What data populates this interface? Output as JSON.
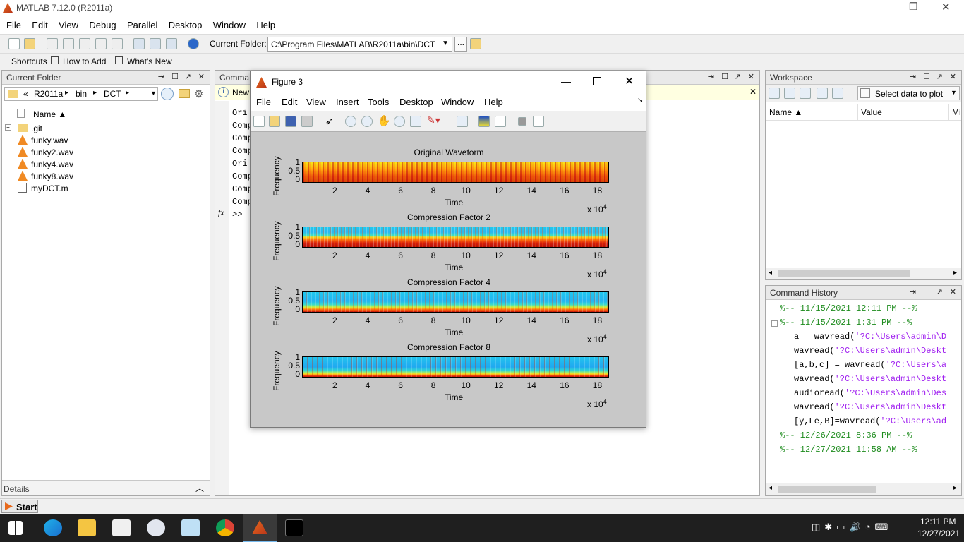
{
  "window": {
    "title": "MATLAB  7.12.0 (R2011a)",
    "min": "—",
    "max": "❐",
    "close": "✕"
  },
  "menu": [
    "File",
    "Edit",
    "View",
    "Debug",
    "Parallel",
    "Desktop",
    "Window",
    "Help"
  ],
  "toolbar": {
    "folder_label": "Current Folder:",
    "folder_path": "C:\\Program Files\\MATLAB\\R2011a\\bin\\DCT",
    "browse": "..."
  },
  "shortcuts": {
    "label": "Shortcuts",
    "how_to_add": "How to Add",
    "whats_new": "What's New"
  },
  "current_folder": {
    "title": "Current Folder",
    "path": [
      "«",
      "R2011a",
      "▸",
      "bin",
      "▸",
      "DCT",
      "▸"
    ],
    "col_name": "Name ▲",
    "files": [
      {
        "name": ".git",
        "icon": "folder-icon"
      },
      {
        "name": "funky.wav",
        "icon": "vlc-icon"
      },
      {
        "name": "funky2.wav",
        "icon": "vlc-icon"
      },
      {
        "name": "funky4.wav",
        "icon": "vlc-icon"
      },
      {
        "name": "funky8.wav",
        "icon": "vlc-icon"
      },
      {
        "name": "myDCT.m",
        "icon": "mfile-icon"
      }
    ],
    "details": "Details"
  },
  "command_window": {
    "title": "Comma",
    "banner": "New",
    "lines": [
      "Ori",
      "Comp",
      "Comp",
      "Comp",
      "Ori",
      "Comp",
      "Comp",
      "Comp"
    ],
    "prompt": ">>",
    "fx": "fx"
  },
  "workspace": {
    "title": "Workspace",
    "select_data": "Select data to plot",
    "col_name": "Name ▲",
    "col_value": "Value",
    "col_min": "Mi"
  },
  "history": {
    "title": "Command History",
    "entries": [
      {
        "text": "%-- 11/15/2021 12:11 PM --%",
        "kind": "sep"
      },
      {
        "text": "%-- 11/15/2021 1:31 PM --%",
        "kind": "sep"
      },
      {
        "cmd": "a = wavread(",
        "arg": "'?C:\\Users\\admin\\D",
        "kind": "cmd"
      },
      {
        "cmd": "wavread(",
        "arg": "'?C:\\Users\\admin\\Deskt",
        "kind": "cmd"
      },
      {
        "cmd": "[a,b,c] = wavread(",
        "arg": "'?C:\\Users\\a",
        "kind": "cmd"
      },
      {
        "cmd": "wavread(",
        "arg": "'?C:\\Users\\admin\\Deskt",
        "kind": "cmd"
      },
      {
        "cmd": "audioread(",
        "arg": "'?C:\\Users\\admin\\Des",
        "kind": "cmd"
      },
      {
        "cmd": "wavread(",
        "arg": "'?C:\\Users\\admin\\Deskt",
        "kind": "cmd"
      },
      {
        "cmd": "[y,Fe,B]=wavread(",
        "arg": "'?C:\\Users\\ad",
        "kind": "cmd"
      },
      {
        "text": "%-- 12/26/2021 8:36 PM --%",
        "kind": "sep"
      },
      {
        "text": "%-- 12/27/2021 11:58 AM --%",
        "kind": "sep"
      }
    ]
  },
  "figure": {
    "title": "Figure 3",
    "menu": [
      "File",
      "Edit",
      "View",
      "Insert",
      "Tools",
      "Desktop",
      "Window",
      "Help"
    ],
    "plots": [
      {
        "title": "Original Waveform",
        "style": "orig"
      },
      {
        "title": "Compression Factor 2",
        "style": "c2"
      },
      {
        "title": "Compression Factor 4",
        "style": "c4"
      },
      {
        "title": "Compression Factor 8",
        "style": "c8"
      }
    ],
    "xticks": [
      "2",
      "4",
      "6",
      "8",
      "10",
      "12",
      "14",
      "16",
      "18"
    ],
    "yticks": [
      "1",
      "0.5",
      "0"
    ],
    "xlabel": "Time",
    "ylabel": "Frequency",
    "exponent_base": "x 10",
    "exponent_power": "4"
  },
  "status": {
    "start": "Start"
  },
  "taskbar": {
    "time": "12:11 PM",
    "date": "12/27/2021"
  },
  "colors": {
    "history_sep": "#1e8c1e",
    "history_arg": "#a020f0",
    "accent": "#0078d7"
  }
}
